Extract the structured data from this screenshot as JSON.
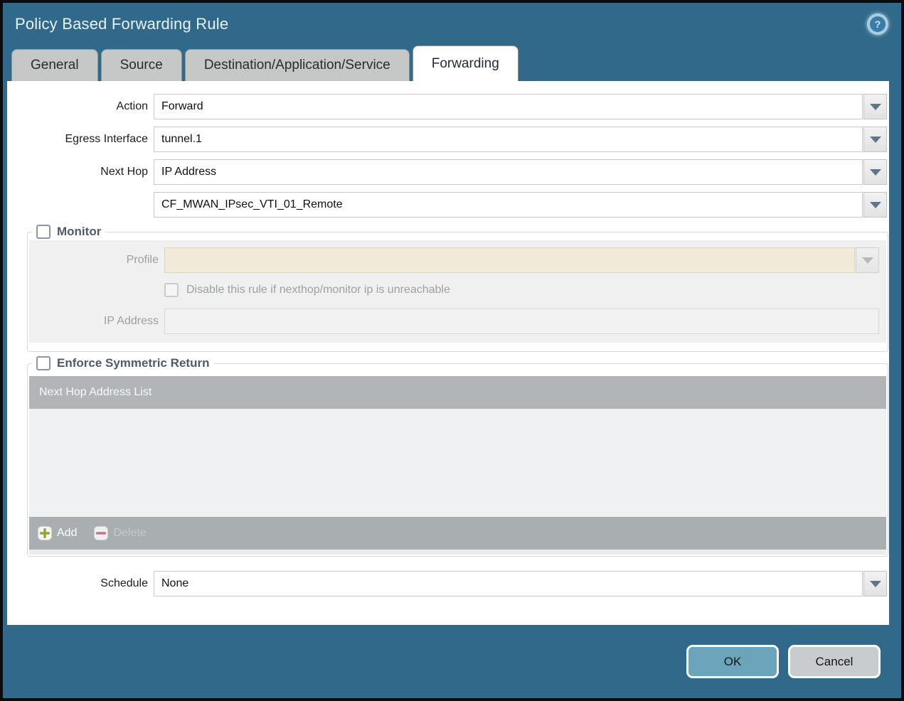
{
  "dialog": {
    "title": "Policy Based Forwarding Rule",
    "help_glyph": "?"
  },
  "tabs": [
    {
      "label": "General",
      "active": false
    },
    {
      "label": "Source",
      "active": false
    },
    {
      "label": "Destination/Application/Service",
      "active": false
    },
    {
      "label": "Forwarding",
      "active": true
    }
  ],
  "form": {
    "action": {
      "label": "Action",
      "value": "Forward"
    },
    "egress_interface": {
      "label": "Egress Interface",
      "value": "tunnel.1"
    },
    "next_hop": {
      "label": "Next Hop",
      "value": "IP Address"
    },
    "next_hop_address": {
      "value": "CF_MWAN_IPsec_VTI_01_Remote"
    },
    "schedule": {
      "label": "Schedule",
      "value": "None"
    }
  },
  "monitor": {
    "legend": "Monitor",
    "checked": false,
    "profile": {
      "label": "Profile",
      "value": ""
    },
    "disable_rule": {
      "label": "Disable this rule if nexthop/monitor ip is unreachable",
      "checked": false
    },
    "ip_address": {
      "label": "IP Address",
      "value": ""
    }
  },
  "symmetric_return": {
    "legend": "Enforce Symmetric Return",
    "checked": false,
    "table": {
      "header": "Next Hop Address List",
      "rows": []
    },
    "add_label": "Add",
    "delete_label": "Delete"
  },
  "footer": {
    "ok_label": "OK",
    "cancel_label": "Cancel"
  },
  "colors": {
    "frame_teal": "#31698b",
    "ok_button": "#6ba4bb",
    "cancel_button": "#c9cccf",
    "disabled_field_beige": "#f1ead8",
    "table_header_gray": "#b1b5b8",
    "table_footer_gray": "#a9aeb1",
    "add_plus_green": "#93a23c",
    "delete_minus_red": "#c9767f",
    "legend_text": "#4c5b6e"
  }
}
